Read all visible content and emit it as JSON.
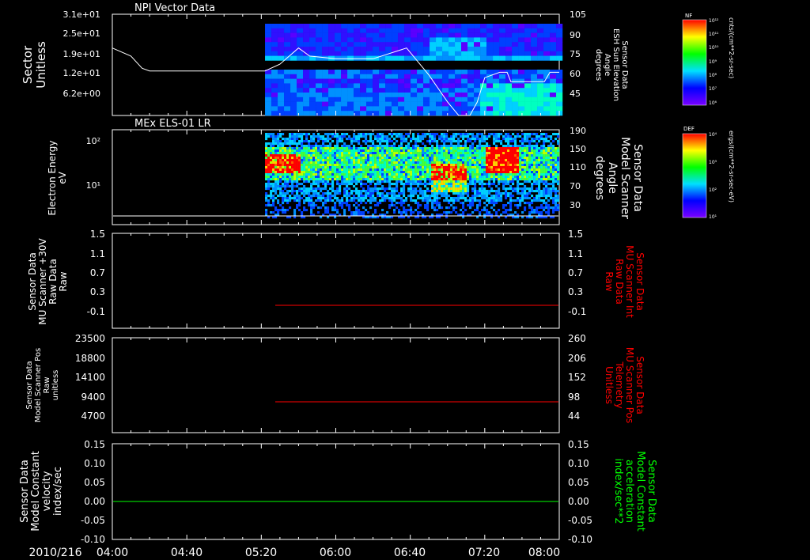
{
  "date_label": "2010/216",
  "x_axis": {
    "start": "04:00",
    "end": "08:00",
    "tick_labels": [
      "04:00",
      "04:40",
      "05:20",
      "06:00",
      "06:40",
      "07:20",
      "08:00"
    ]
  },
  "colors": {
    "background": "#000000",
    "foreground": "#ffffff",
    "red_trace": "#ff0000",
    "green_trace": "#00ff00"
  },
  "panels": [
    {
      "title": "NPI Vector Data",
      "type": "spectrogram",
      "left_label": [
        "Sector",
        "Unitless"
      ],
      "left_ticks": [
        "3.1e+01",
        "2.5e+01",
        "1.9e+01",
        "1.2e+01",
        "6.2e+00"
      ],
      "right_label": [
        "Sensor Data",
        "ESH Sun Elevation",
        "Angle",
        "degrees"
      ],
      "right_ticks": [
        "105",
        "90",
        "75",
        "60",
        "45"
      ],
      "colorbar": {
        "tag": "NF",
        "top": "10¹²",
        "labels": [
          "10¹²",
          "10¹¹",
          "10¹⁰",
          "10⁹",
          "10⁸",
          "10⁷",
          "10⁶"
        ],
        "bottom": "10⁶",
        "units": "cnts/(cm**2-sr-sec)"
      }
    },
    {
      "title": "MEx ELS-01 LR",
      "type": "spectrogram",
      "left_label": [
        "Electron Energy",
        "eV"
      ],
      "left_ticks": [
        "10²",
        "10¹"
      ],
      "right_label": [
        "Sensor Data",
        "Model Scanner",
        "Angle",
        "degrees"
      ],
      "right_ticks": [
        "190",
        "150",
        "110",
        "70",
        "30"
      ],
      "colorbar": {
        "tag": "DEF",
        "top": "10⁴",
        "labels": [
          "10⁴",
          "10³",
          "10²",
          "10¹"
        ],
        "bottom": "10¹",
        "units": "ergs/(cm**2-sr-sec-eV)"
      }
    },
    {
      "type": "line",
      "left_label": [
        "Sensor Data",
        "MU Scanner +30V",
        "Raw Data",
        "Raw"
      ],
      "left_ticks": [
        "1.5",
        "1.1",
        "0.7",
        "0.3",
        "-0.1"
      ],
      "right_label": [
        "Sensor Data",
        "MU Scanner Int",
        "Raw Data",
        "Raw"
      ],
      "right_ticks": [
        "1.5",
        "1.1",
        "0.7",
        "0.3",
        "-0.1"
      ]
    },
    {
      "type": "line",
      "left_label": [
        "Sensor Data",
        "Model Scanner Pos",
        "Raw",
        "unitless"
      ],
      "left_ticks": [
        "23500",
        "18800",
        "14100",
        "9400",
        "4700"
      ],
      "right_label": [
        "Sensor Data",
        "MU Scanner Pos",
        "Telemetry",
        "Unitless"
      ],
      "right_ticks": [
        "260",
        "206",
        "152",
        "98",
        "44"
      ]
    },
    {
      "type": "line",
      "left_label": [
        "Sensor Data",
        "Model Constant",
        "velocity",
        "index/sec"
      ],
      "left_ticks": [
        "0.15",
        "0.10",
        "0.05",
        "0.00",
        "-0.05",
        "-0.10"
      ],
      "right_label": [
        "Sensor Data",
        "Model Constant",
        "acceleration",
        "index/sec**2"
      ],
      "right_ticks": [
        "0.15",
        "0.10",
        "0.05",
        "0.00",
        "-0.05",
        "-0.10"
      ]
    }
  ],
  "chart_data": [
    {
      "type": "heatmap",
      "title": "NPI Vector Data",
      "x": [
        "04:00",
        "08:00"
      ],
      "data_start": "05:22",
      "ylim": [
        0,
        33
      ],
      "ylim_right": [
        30,
        105
      ],
      "overlay_series": {
        "name": "ESH Sun Elevation Angle",
        "x": [
          "04:00",
          "04:10",
          "04:16",
          "04:20",
          "05:22",
          "05:30",
          "05:40",
          "05:46",
          "06:00",
          "06:20",
          "06:38",
          "06:50",
          "07:00",
          "07:06",
          "07:12",
          "07:16",
          "07:20",
          "07:28",
          "07:32",
          "07:34",
          "07:52",
          "07:55",
          "08:00"
        ],
        "y": [
          80,
          74,
          65,
          63,
          63,
          68,
          80,
          74,
          72,
          72,
          80,
          60,
          40,
          30,
          30,
          40,
          58,
          62,
          62,
          55,
          55,
          62,
          62
        ]
      }
    },
    {
      "type": "heatmap",
      "title": "MEx ELS-01 LR",
      "x": [
        "04:00",
        "08:00"
      ],
      "data_start": "05:22",
      "ylog": true,
      "ylim": [
        1,
        200
      ],
      "ylim_right": [
        10,
        190
      ],
      "overlay_series": {
        "name": "Model Scanner Angle",
        "x": [
          "04:00",
          "08:00"
        ],
        "y": [
          10,
          10
        ]
      }
    },
    {
      "type": "line",
      "x": [
        "04:00",
        "08:00"
      ],
      "ylim": [
        -0.3,
        1.5
      ],
      "series": [
        {
          "name": "MU Scanner Int Raw Data",
          "x": [
            "05:20",
            "08:00"
          ],
          "y": [
            0,
            0
          ]
        }
      ]
    },
    {
      "type": "line",
      "x": [
        "04:00",
        "08:00"
      ],
      "ylim": [
        0,
        23500
      ],
      "ylim_right": [
        0,
        260
      ],
      "series": [
        {
          "name": "MU Scanner Pos Telemetry",
          "x": [
            "05:20",
            "08:00"
          ],
          "y": [
            90,
            90
          ]
        }
      ]
    },
    {
      "type": "line",
      "x": [
        "04:00",
        "08:00"
      ],
      "ylim": [
        -0.1,
        0.15
      ],
      "series": [
        {
          "name": "Model Constant acceleration",
          "x": [
            "04:00",
            "08:00"
          ],
          "y": [
            0,
            0
          ]
        }
      ]
    }
  ]
}
